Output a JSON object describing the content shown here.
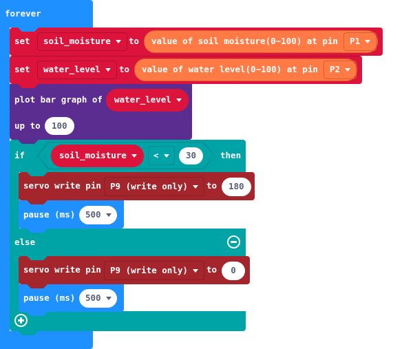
{
  "colors": {
    "loops": "#1e90ff",
    "variables": "#dc143c",
    "pins": "#ff7a45",
    "led": "#5c2d91",
    "logic": "#00a4a6",
    "servo": "#a4262c"
  },
  "forever": {
    "label": "forever"
  },
  "set_soil": {
    "set_label": "set",
    "variable": "soil_moisture",
    "to_label": "to",
    "sensor_label": "value of soil moisture(0~100) at pin",
    "pin": "P1"
  },
  "set_water": {
    "set_label": "set",
    "variable": "water_level",
    "to_label": "to",
    "sensor_label": "value of water level(0~100) at pin",
    "pin": "P2"
  },
  "plot": {
    "label": "plot bar graph of",
    "variable": "water_level",
    "up_to_label": "up to",
    "up_to_value": "100"
  },
  "if_block": {
    "if_label": "if",
    "variable": "soil_moisture",
    "operator": "<",
    "compare_value": "30",
    "then_label": "then",
    "else_label": "else"
  },
  "servo_then": {
    "label": "servo write pin",
    "pin": "P9 (write only)",
    "to_label": "to",
    "value": "180"
  },
  "pause_then": {
    "label": "pause (ms)",
    "value": "500"
  },
  "servo_else": {
    "label": "servo write pin",
    "pin": "P9 (write only)",
    "to_label": "to",
    "value": "0"
  },
  "pause_else": {
    "label": "pause (ms)",
    "value": "500"
  }
}
